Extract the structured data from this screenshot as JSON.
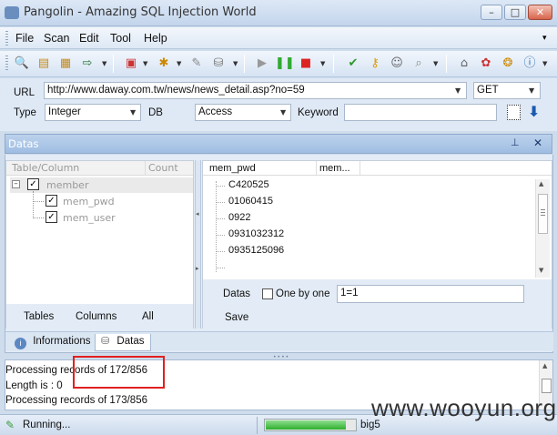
{
  "window": {
    "title": "Pangolin - Amazing SQL Injection World"
  },
  "menu": [
    "File",
    "Scan",
    "Edit",
    "Tool",
    "Help"
  ],
  "form": {
    "url_label": "URL",
    "url_value": "http://www.daway.com.tw/news/news_detail.asp?no=59",
    "method": "GET",
    "type_label": "Type",
    "type_value": "Integer",
    "db_label": "DB",
    "db_value": "Access",
    "keyword_label": "Keyword",
    "keyword_value": ""
  },
  "datas_panel": {
    "title": "Datas",
    "tree_headers": [
      "Table/Column",
      "Count"
    ],
    "tree": {
      "table": "member",
      "columns": [
        "mem_pwd",
        "mem_user"
      ]
    },
    "bottom_buttons": [
      "Tables",
      "Columns",
      "All"
    ],
    "data_headers": [
      "mem_pwd",
      "mem..."
    ],
    "rows": [
      "C420525",
      "01060415",
      "0922",
      "0931032312",
      "0935125096",
      ""
    ],
    "datas_label": "Datas",
    "one_by_one_label": "One by one",
    "filter_value": "1=1",
    "save_label": "Save"
  },
  "tabs": [
    "Informations",
    "Datas"
  ],
  "log": [
    "Processing records of 172/856",
    "Length is : 0",
    "Processing records of 173/856"
  ],
  "status": {
    "text": "Running...",
    "encoding": "big5",
    "progress": 0.9
  },
  "highlight_color": "#e02020",
  "watermark": "www.wooyun.org"
}
